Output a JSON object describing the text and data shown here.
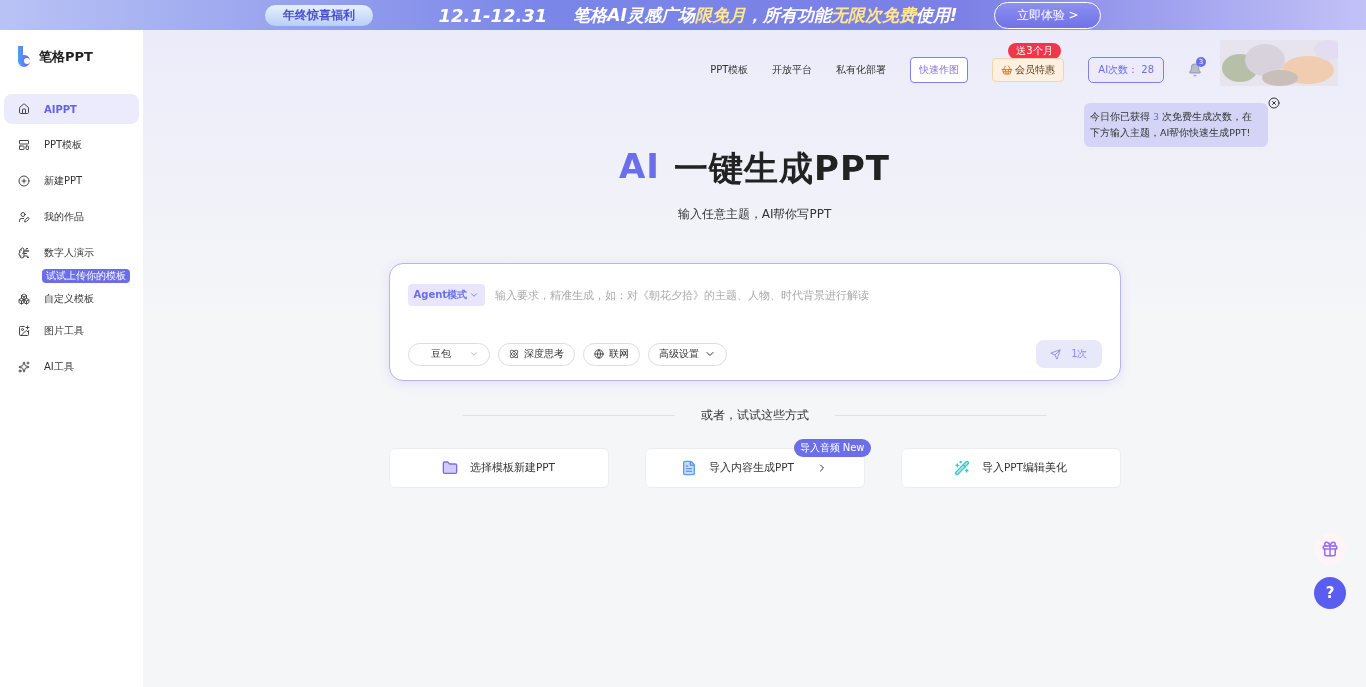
{
  "banner": {
    "pill": "年终惊喜福利",
    "dates": "12.1-12.31",
    "headline": "笔格AI灵感广场**限免月**，所有功能**无限次免费**使用!",
    "cta": "立即体验 >"
  },
  "sidebar": {
    "logo": "笔格PPT",
    "items": [
      {
        "label": "AIPPT",
        "selected": true
      },
      {
        "label": "PPT模板",
        "selected": false
      },
      {
        "label": "新建PPT",
        "selected": false
      },
      {
        "label": "我的作品",
        "selected": false
      },
      {
        "label": "数字人演示",
        "selected": false
      },
      {
        "label": "自定义模板",
        "selected": false,
        "badge": "试试上传你的模板"
      },
      {
        "label": "图片工具",
        "selected": false
      },
      {
        "label": "AI工具",
        "selected": false
      }
    ]
  },
  "topnav": {
    "links": [
      "PPT模板",
      "开放平台",
      "私有化部署"
    ],
    "quick_draw": "快速作图",
    "vip": {
      "label": "会员特惠",
      "badge": "送3个月"
    },
    "ai_count": "AI次数： 28",
    "notifications": "3"
  },
  "tooltip": {
    "text": "今日你已获得 **3** 次免费生成次数，在下方输入主题，AI帮你快速生成PPT!"
  },
  "hero": {
    "accent": "AI",
    "title": "一键生成PPT",
    "subtitle": "输入任意主题，AI帮你写PPT"
  },
  "composer": {
    "mode": "Agent模式",
    "placeholder": "输入要求，精准生成，如：对《朝花夕拾》的主题、人物、时代背景进行解读",
    "model": "豆包",
    "toggles": [
      {
        "label": "深度思考",
        "on": false
      },
      {
        "label": "联网",
        "on": false
      }
    ],
    "advanced": "高级设置",
    "send": {
      "label": "1次",
      "disabled": true
    }
  },
  "alternatives": {
    "divider": "或者，试试这些方式",
    "options": [
      {
        "label": "选择模板新建PPT"
      },
      {
        "label": "导入内容生成PPT",
        "badge": "导入音频 New"
      },
      {
        "label": "导入PPT编辑美化"
      }
    ]
  },
  "help": "?"
}
